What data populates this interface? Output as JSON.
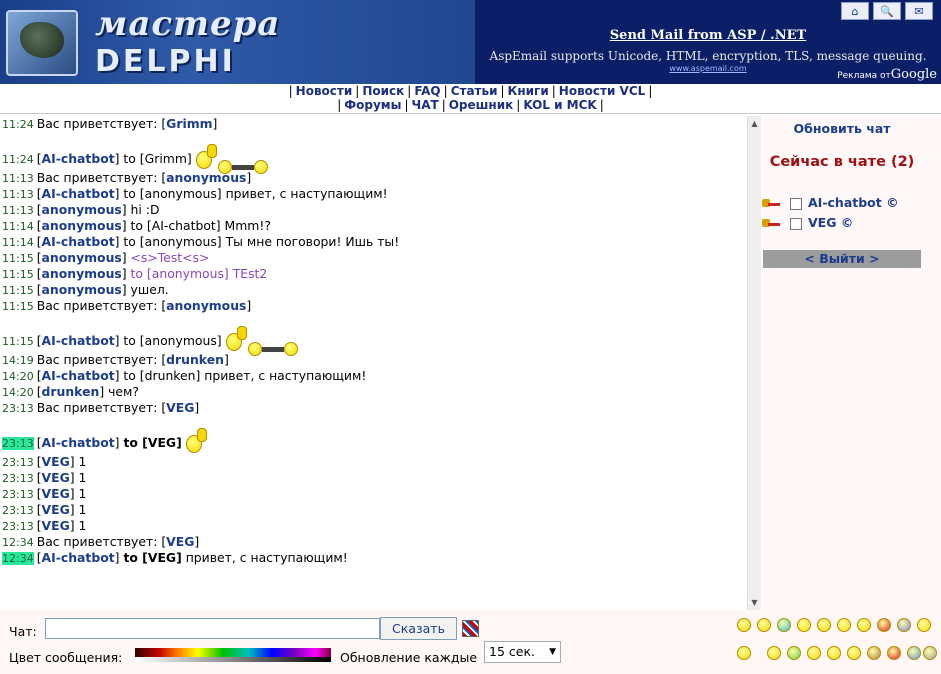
{
  "header": {
    "logo_line1": "мастера",
    "logo_line2": "DELPHI",
    "ad_title": "Send Mail from ASP / .NET",
    "ad_text": "AspEmail supports Unicode, HTML, encryption, TLS, message queuing.",
    "ad_url": "www.aspemail.com",
    "ads_by": "Реклама от",
    "ads_brand": "Google",
    "icons": [
      "home-icon",
      "search-icon",
      "mail-icon"
    ]
  },
  "nav": {
    "row1": [
      "Новости",
      "Поиск",
      "FAQ",
      "Статьи",
      "Книги",
      "Новости VCL"
    ],
    "row2": [
      "Форумы",
      "ЧАТ",
      "Орешник",
      "KOL и MCK"
    ]
  },
  "messages": [
    {
      "time": "11:24",
      "parts": [
        {
          "t": "Вас приветствует: ["
        },
        {
          "n": "Grimm"
        },
        {
          "t": "]"
        }
      ]
    },
    {
      "gap": true
    },
    {
      "time": "11:24",
      "parts": [
        {
          "t": "["
        },
        {
          "n": "AI-chatbot"
        },
        {
          "t": "] to [Grimm]"
        }
      ],
      "emotes": [
        "wave",
        "glasses"
      ]
    },
    {
      "time": "11:13",
      "parts": [
        {
          "t": "Вас приветствует: ["
        },
        {
          "n": "anonymous"
        },
        {
          "t": "]"
        }
      ]
    },
    {
      "time": "11:13",
      "parts": [
        {
          "t": "["
        },
        {
          "n": "AI-chatbot"
        },
        {
          "t": "] to [anonymous] привет, с наступающим!"
        }
      ]
    },
    {
      "time": "11:13",
      "parts": [
        {
          "t": "["
        },
        {
          "n": "anonymous"
        },
        {
          "t": "] hi :D"
        }
      ]
    },
    {
      "time": "11:14",
      "parts": [
        {
          "t": "["
        },
        {
          "n": "anonymous"
        },
        {
          "t": "] to [AI-chatbot] Mmm!?"
        }
      ]
    },
    {
      "time": "11:14",
      "parts": [
        {
          "t": "["
        },
        {
          "n": "AI-chatbot"
        },
        {
          "t": "] to [anonymous] Ты мне поговори! Ишь ты!"
        }
      ]
    },
    {
      "time": "11:15",
      "parts": [
        {
          "t": "["
        },
        {
          "n": "anonymous"
        },
        {
          "t": "] "
        },
        {
          "p": "<s>Test<s>"
        }
      ]
    },
    {
      "time": "11:15",
      "parts": [
        {
          "t": "["
        },
        {
          "n": "anonymous"
        },
        {
          "t": "] "
        },
        {
          "p": "to [anonymous] TEst2"
        }
      ]
    },
    {
      "time": "11:15",
      "parts": [
        {
          "t": "["
        },
        {
          "n": "anonymous"
        },
        {
          "t": "] ушел."
        }
      ]
    },
    {
      "time": "11:15",
      "parts": [
        {
          "t": "Вас приветствует: ["
        },
        {
          "n": "anonymous"
        },
        {
          "t": "]"
        }
      ]
    },
    {
      "gap": true
    },
    {
      "time": "11:15",
      "parts": [
        {
          "t": "["
        },
        {
          "n": "AI-chatbot"
        },
        {
          "t": "] to [anonymous]"
        }
      ],
      "emotes": [
        "wave",
        "glasses"
      ]
    },
    {
      "time": "14:19",
      "parts": [
        {
          "t": "Вас приветствует: ["
        },
        {
          "n": "drunken"
        },
        {
          "t": "]"
        }
      ]
    },
    {
      "time": "14:20",
      "parts": [
        {
          "t": "["
        },
        {
          "n": "AI-chatbot"
        },
        {
          "t": "] to [drunken] привет, с наступающим!"
        }
      ]
    },
    {
      "time": "14:20",
      "parts": [
        {
          "t": "["
        },
        {
          "n": "drunken"
        },
        {
          "t": "] чем?"
        }
      ]
    },
    {
      "time": "23:13",
      "parts": [
        {
          "t": "Вас приветствует: ["
        },
        {
          "n": "VEG"
        },
        {
          "t": "]"
        }
      ]
    },
    {
      "gap": true
    },
    {
      "time": "23:13",
      "hl": true,
      "parts": [
        {
          "t": "["
        },
        {
          "n": "AI-chatbot"
        },
        {
          "t": "] "
        },
        {
          "b": "to [VEG]"
        }
      ],
      "emotes": [
        "wave"
      ]
    },
    {
      "time": "23:13",
      "parts": [
        {
          "t": "["
        },
        {
          "n": "VEG"
        },
        {
          "t": "] 1"
        }
      ]
    },
    {
      "time": "23:13",
      "parts": [
        {
          "t": "["
        },
        {
          "n": "VEG"
        },
        {
          "t": "] 1"
        }
      ]
    },
    {
      "time": "23:13",
      "parts": [
        {
          "t": "["
        },
        {
          "n": "VEG"
        },
        {
          "t": "] 1"
        }
      ]
    },
    {
      "time": "23:13",
      "parts": [
        {
          "t": "["
        },
        {
          "n": "VEG"
        },
        {
          "t": "] 1"
        }
      ]
    },
    {
      "time": "23:13",
      "parts": [
        {
          "t": "["
        },
        {
          "n": "VEG"
        },
        {
          "t": "] 1"
        }
      ]
    },
    {
      "time": "12:34",
      "parts": [
        {
          "t": "Вас приветствует: ["
        },
        {
          "n": "VEG"
        },
        {
          "t": "]"
        }
      ]
    },
    {
      "time": "12:34",
      "hl": true,
      "parts": [
        {
          "t": "["
        },
        {
          "n": "AI-chatbot"
        },
        {
          "t": "] "
        },
        {
          "b": "to [VEG]"
        },
        {
          "t": " привет, с наступающим!"
        }
      ]
    }
  ],
  "sidebar": {
    "refresh_label": "Обновить чат",
    "now_label": "Сейчас в чате (2)",
    "users": [
      "AI-chatbot ©",
      "VEG ©"
    ],
    "exit_label": "< Выйти >"
  },
  "footer": {
    "chat_label": "Чат:",
    "chat_value": "",
    "say_label": "Сказать",
    "color_label": "Цвет сообщения:",
    "refresh_label": "Обновление каждые",
    "interval_value": "15 сек."
  }
}
